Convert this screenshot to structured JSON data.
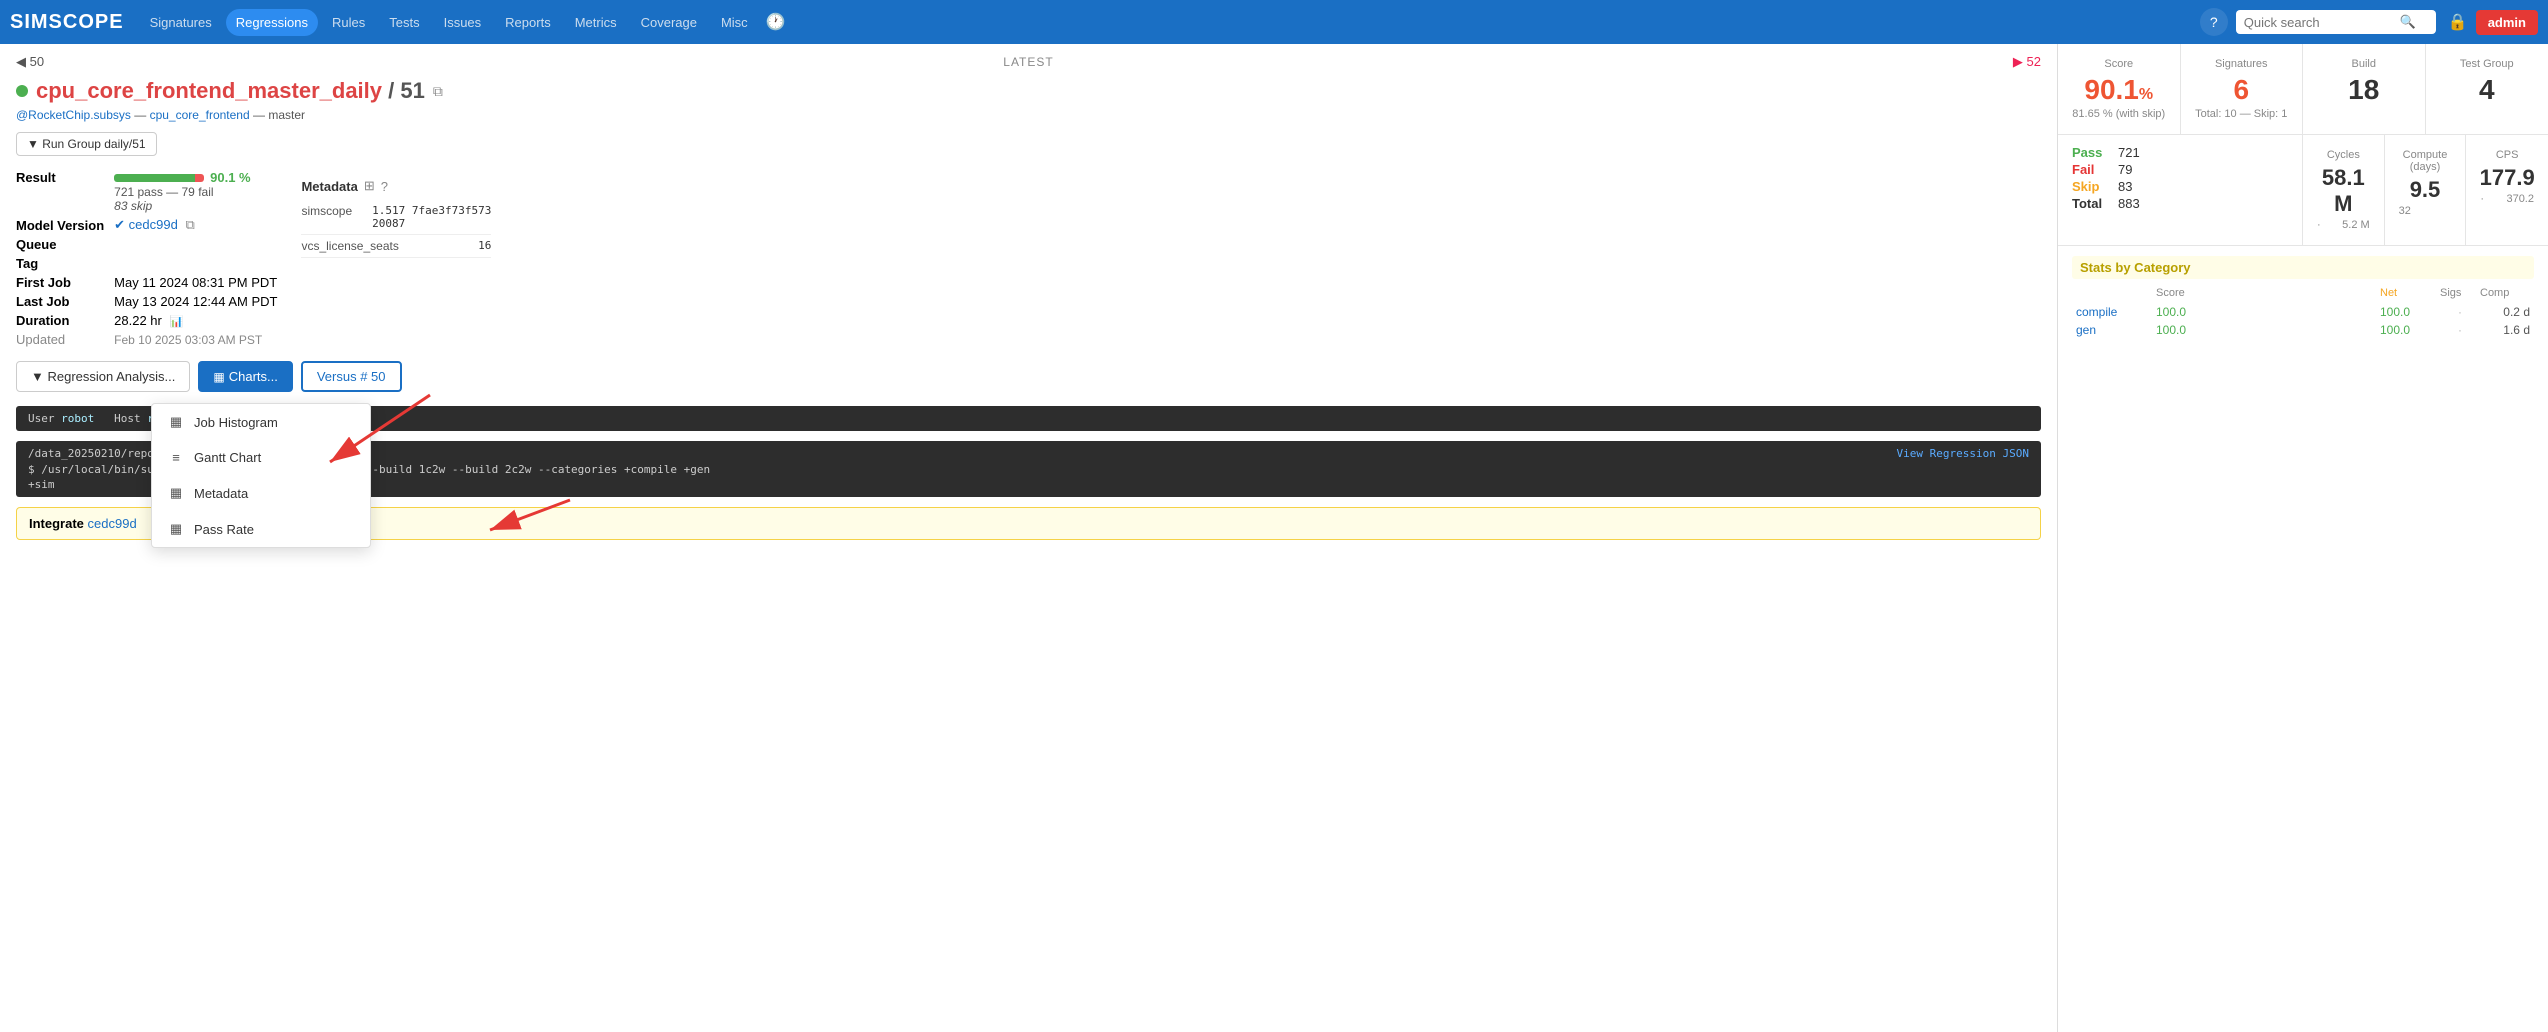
{
  "app": {
    "logo": "SIMSCOPE",
    "nav_items": [
      {
        "label": "Signatures",
        "active": false
      },
      {
        "label": "Regressions",
        "active": true
      },
      {
        "label": "Rules",
        "active": false
      },
      {
        "label": "Tests",
        "active": false
      },
      {
        "label": "Issues",
        "active": false
      },
      {
        "label": "Reports",
        "active": false
      },
      {
        "label": "Metrics",
        "active": false
      },
      {
        "label": "Coverage",
        "active": false
      },
      {
        "label": "Misc",
        "active": false
      }
    ],
    "search_placeholder": "Quick search",
    "admin_label": "admin"
  },
  "header": {
    "prev_num": "◀ 50",
    "latest": "LATEST",
    "next_num": "▶ 52"
  },
  "run": {
    "title": "cpu_core_frontend_master_daily",
    "run_number": "/ 51",
    "subsys": "@RocketChip.subsys",
    "group": "cpu_core_frontend",
    "branch": "master",
    "run_group_label": "▼ Run Group  daily/51",
    "result_label": "Result",
    "result_pass": "721 pass — 79 fail",
    "result_skip": "83 skip",
    "result_pct": "90.1 %",
    "model_version_label": "Model Version",
    "model_hash": "cedc99d",
    "queue_label": "Queue",
    "tag_label": "Tag",
    "first_job_label": "First Job",
    "first_job_value": "May 11 2024 08:31 PM PDT",
    "last_job_label": "Last Job",
    "last_job_value": "May 13 2024 12:44 AM PDT",
    "duration_label": "Duration",
    "duration_value": "28.22 hr",
    "updated_label": "Updated",
    "updated_value": "Feb 10 2025 03:03 AM PST"
  },
  "metadata": {
    "label": "Metadata",
    "rows": [
      {
        "key": "simscope",
        "val": "1.517 7fae3f73f573 20087"
      },
      {
        "key": "vcs_license_seats",
        "val": "16"
      }
    ]
  },
  "buttons": {
    "regression_analysis": "▼ Regression Analysis...",
    "charts": "Charts...",
    "versus": "Versus # 50"
  },
  "dropdown": {
    "items": [
      {
        "icon": "▦",
        "label": "Job Histogram"
      },
      {
        "icon": "≡",
        "label": "Gantt Chart"
      },
      {
        "icon": "▦",
        "label": "Metadata"
      },
      {
        "icon": "▦",
        "label": "Pass Rate"
      }
    ]
  },
  "command": {
    "path": "/data_20250210/repo/cpu/core/frontend",
    "view_json": "View Regression JSON",
    "flags": "+frontend.opt --build 1c1w --build 1c2w --build 2c2w --categories +compile +gen"
  },
  "integrate": {
    "label": "Integrate",
    "link": "cedc99d"
  },
  "right_panel": {
    "score_label": "Score",
    "score_value": "90.1",
    "score_pct": "%",
    "score_sub": "81.65 % (with skip)",
    "signatures_label": "Signatures",
    "signatures_value": "6",
    "signatures_sub": "Total: 10 — Skip: 1",
    "build_label": "Build",
    "build_value": "18",
    "test_group_label": "Test Group",
    "test_group_value": "4",
    "pass_label": "Pass",
    "pass_value": "721",
    "fail_label": "Fail",
    "fail_value": "79",
    "skip_label": "Skip",
    "skip_value": "83",
    "total_label": "Total",
    "total_value": "883",
    "cycles_label": "Cycles",
    "cycles_value": "58.1 M",
    "cycles_sub": "5.2 M",
    "compute_label": "Compute (days)",
    "compute_value": "9.5",
    "compute_sub": "32",
    "cps_label": "CPS",
    "cps_value": "177.9",
    "cps_sub": "370.2",
    "stats_cat_title": "Stats by Category",
    "stats_cat_headers": [
      "",
      "Score",
      "Net",
      "Sigs",
      "Comp"
    ],
    "stats_cat_rows": [
      {
        "name": "compile",
        "score": "100.0",
        "net": "100.0",
        "sigs": "·",
        "comp": "0.2 d"
      },
      {
        "name": "gen",
        "score": "100.0",
        "net": "100.0",
        "sigs": "·",
        "comp": "1.6 d"
      }
    ]
  }
}
